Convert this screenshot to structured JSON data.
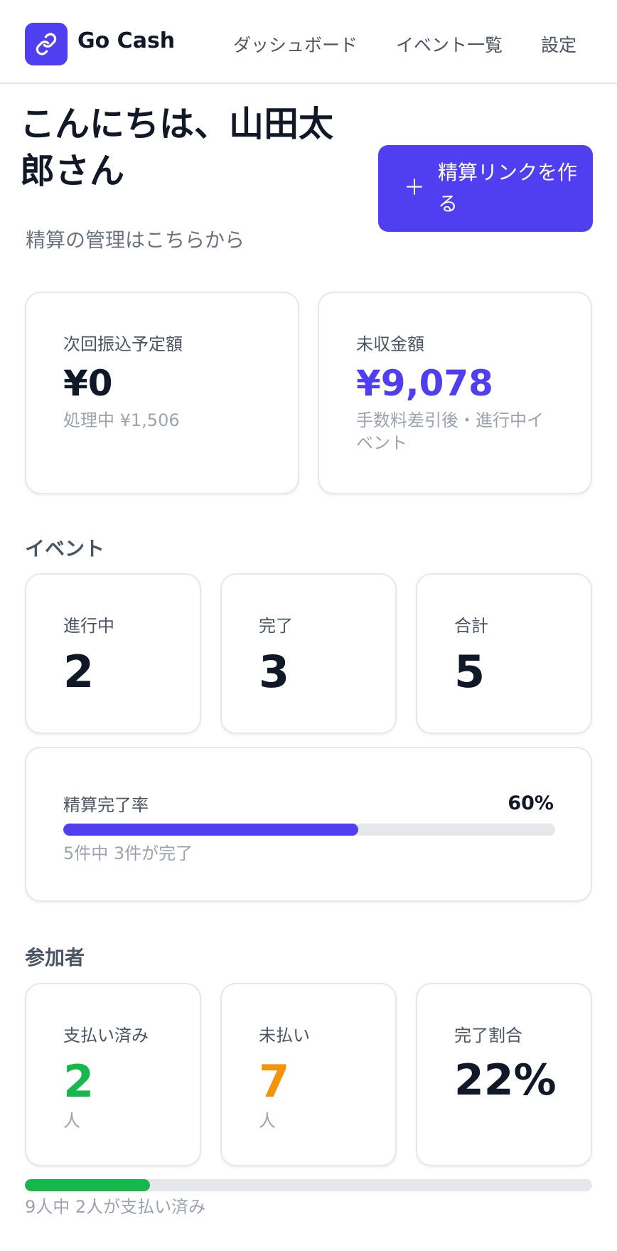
{
  "app": {
    "name": "Go Cash",
    "icon": "link-icon"
  },
  "nav": [
    {
      "label": "ダッシュボード"
    },
    {
      "label": "イベント一覧"
    },
    {
      "label": "設定"
    }
  ],
  "greeting": {
    "title": "こんにちは、山田太郎さん",
    "subtitle": "精算の管理はこちらから"
  },
  "create_button": {
    "label": "精算リンクを作る",
    "icon": "plus-icon"
  },
  "summary": {
    "next_transfer": {
      "label": "次回振込予定額",
      "value": "¥0",
      "note": "処理中 ¥1,506"
    },
    "uncollected": {
      "label": "未収金額",
      "value": "¥9,078",
      "note": "手数料差引後・進行中イベント"
    }
  },
  "events": {
    "title": "イベント",
    "in_progress": {
      "label": "進行中",
      "value": "2"
    },
    "completed": {
      "label": "完了",
      "value": "3"
    },
    "total": {
      "label": "合計",
      "value": "5"
    },
    "completion": {
      "label": "精算完了率",
      "percent_text": "60%",
      "progress": 0.6,
      "note": "5件中 3件が完了"
    }
  },
  "participants": {
    "title": "参加者",
    "paid": {
      "label": "支払い済み",
      "value": "2",
      "unit": "人"
    },
    "unpaid": {
      "label": "未払い",
      "value": "7",
      "unit": "人"
    },
    "ratio": {
      "label": "完了割合",
      "value": "22%"
    },
    "progress": 0.22,
    "note": "9人中 2人が支払い済み"
  },
  "colors": {
    "accent": "#4f3ff0",
    "paid": "#16b84e",
    "unpaid": "#f5930b",
    "track": "#e5e7eb"
  }
}
